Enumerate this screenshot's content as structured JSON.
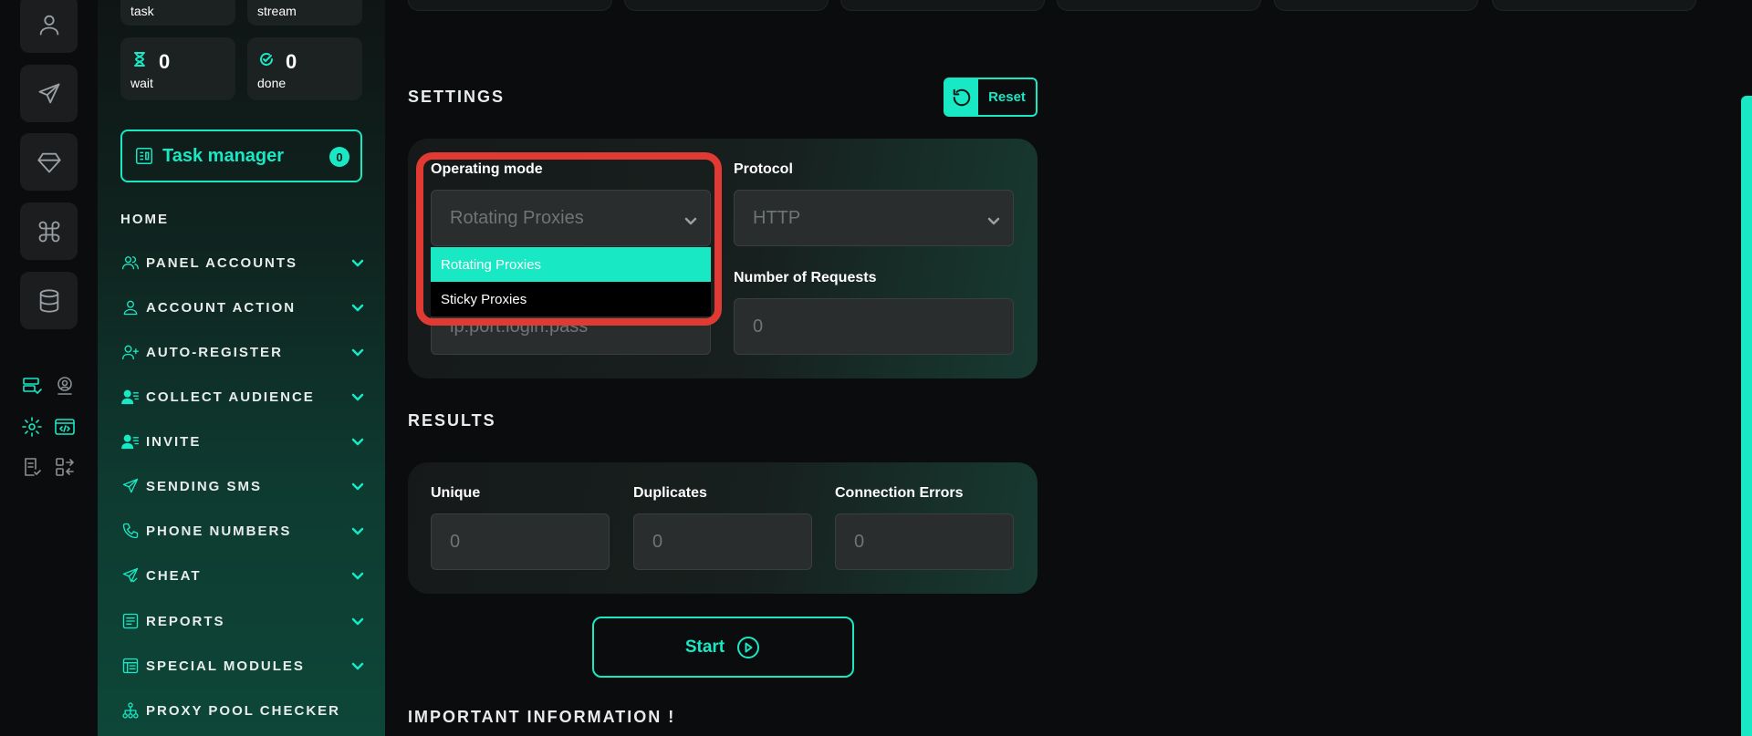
{
  "stats": {
    "task_label": "task",
    "stream_label": "stream",
    "wait": {
      "value": "0",
      "label": "wait"
    },
    "done": {
      "value": "0",
      "label": "done"
    }
  },
  "task_manager": {
    "label": "Task manager",
    "count": "0"
  },
  "nav": {
    "home": "HOME",
    "items": [
      {
        "label": "PANEL ACCOUNTS",
        "icon": "users-icon"
      },
      {
        "label": "ACCOUNT ACTION",
        "icon": "user-icon"
      },
      {
        "label": "AUTO-REGISTER",
        "icon": "user-plus-icon"
      },
      {
        "label": "COLLECT AUDIENCE",
        "icon": "user-list-icon"
      },
      {
        "label": "INVITE",
        "icon": "user-list-icon"
      },
      {
        "label": "SENDING SMS",
        "icon": "send-icon"
      },
      {
        "label": "PHONE NUMBERS",
        "icon": "phone-icon"
      },
      {
        "label": "CHEAT",
        "icon": "send-check-icon"
      },
      {
        "label": "REPORTS",
        "icon": "report-icon"
      },
      {
        "label": "SPECIAL MODULES",
        "icon": "modules-icon"
      },
      {
        "label": "PROXY POOL CHECKER",
        "icon": "network-icon"
      }
    ]
  },
  "settings": {
    "title": "SETTINGS",
    "reset_label": "Reset",
    "operating_mode": {
      "label": "Operating mode",
      "value": "Rotating Proxies",
      "options": [
        "Rotating Proxies",
        "Sticky Proxies"
      ]
    },
    "protocol": {
      "label": "Protocol",
      "value": "HTTP"
    },
    "proxy_input": {
      "placeholder": "ip:port:login:pass"
    },
    "requests": {
      "label": "Number of Requests",
      "value": "0"
    }
  },
  "results": {
    "title": "RESULTS",
    "unique": {
      "label": "Unique",
      "value": "0"
    },
    "duplicates": {
      "label": "Duplicates",
      "value": "0"
    },
    "errors": {
      "label": "Connection Errors",
      "value": "0"
    }
  },
  "start_label": "Start",
  "important_title": "IMPORTANT INFORMATION !",
  "colors": {
    "accent": "#19e8c4",
    "highlight": "#e03a33",
    "background": "#0b0c0d"
  }
}
